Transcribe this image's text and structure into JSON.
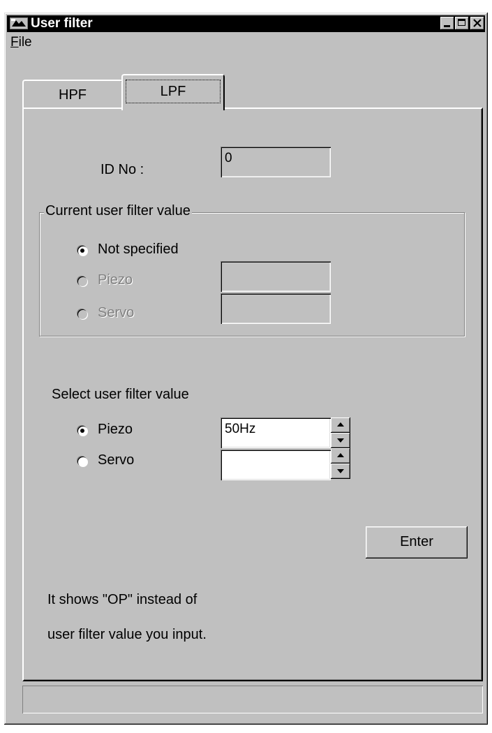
{
  "window": {
    "title": "User filter"
  },
  "menu": {
    "file_first": "F",
    "file_rest": "ile"
  },
  "tabs": [
    {
      "label": "HPF"
    },
    {
      "label": "LPF"
    }
  ],
  "id_row": {
    "label": "ID No :",
    "value": "0"
  },
  "current": {
    "title": "Current user filter value",
    "options": [
      {
        "label": "Not specified",
        "selected": true,
        "enabled": true
      },
      {
        "label": "Piezo",
        "selected": false,
        "enabled": false,
        "value": ""
      },
      {
        "label": "Servo",
        "selected": false,
        "enabled": false,
        "value": ""
      }
    ]
  },
  "select": {
    "title": "Select user filter value",
    "options": [
      {
        "label": "Piezo",
        "selected": true,
        "value": "50Hz"
      },
      {
        "label": "Servo",
        "selected": false,
        "value": ""
      }
    ]
  },
  "enter_button": "Enter",
  "note": {
    "line1": "It shows \"OP\" instead of",
    "line2": "user filter value you input."
  },
  "status": ""
}
